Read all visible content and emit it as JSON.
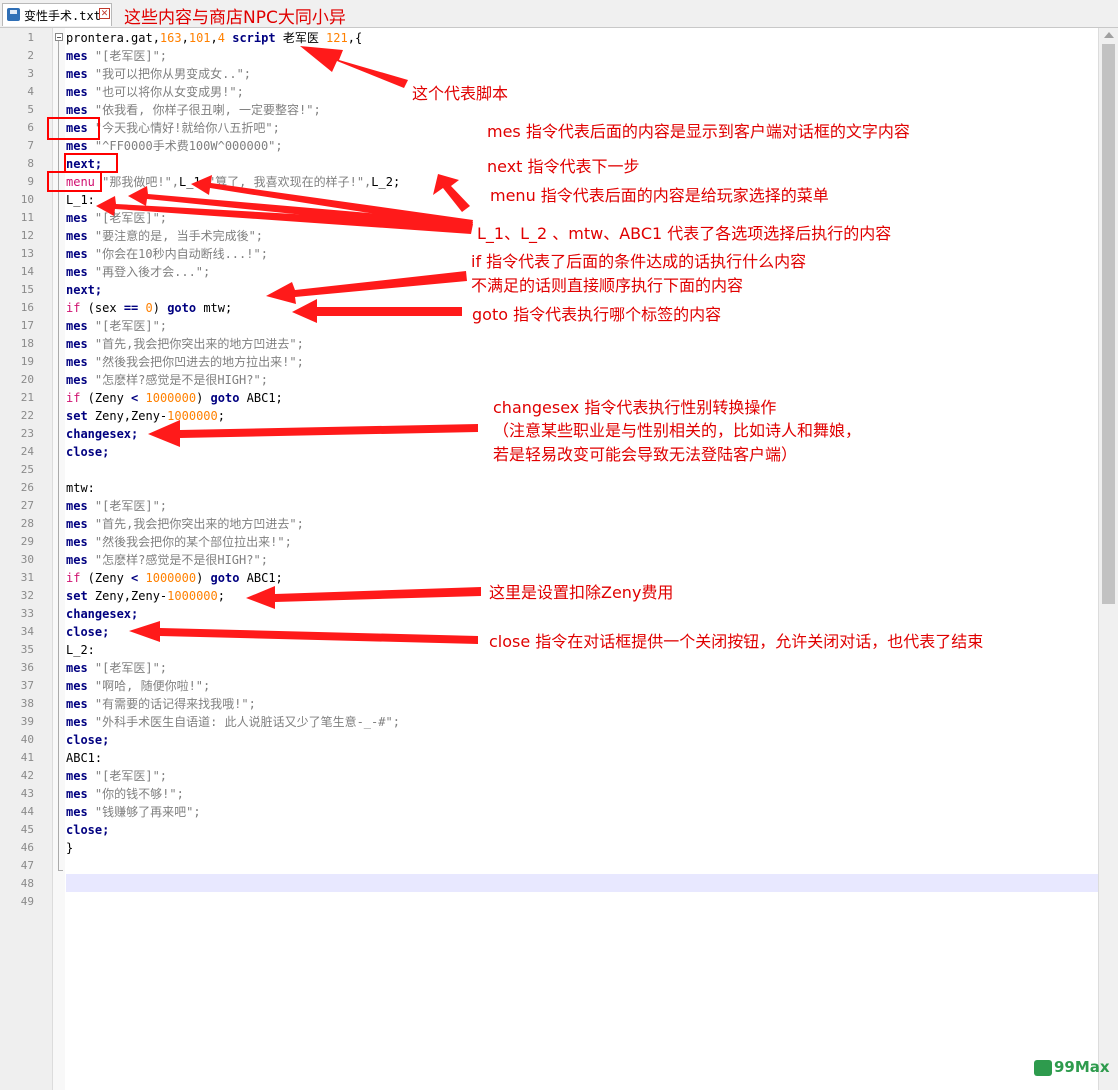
{
  "tab": {
    "title": "变性手术.txt",
    "close_glyph": "✕"
  },
  "header_note": "这些内容与商店NPC大同小异",
  "code_lines": [
    [
      [
        "prontera.gat,",
        ""
      ],
      [
        "163",
        "n"
      ],
      [
        ",",
        ""
      ],
      [
        "101",
        "n"
      ],
      [
        ",",
        ""
      ],
      [
        "4",
        "n"
      ],
      [
        " ",
        ""
      ],
      [
        "script",
        "k"
      ],
      [
        " 老军医 ",
        ""
      ],
      [
        "121",
        "n"
      ],
      [
        ",{",
        ""
      ]
    ],
    [
      [
        "mes",
        "k"
      ],
      [
        " \"[老军医]\";",
        "s"
      ]
    ],
    [
      [
        "mes",
        "k"
      ],
      [
        " \"我可以把你从男变成女..\";",
        "s"
      ]
    ],
    [
      [
        "mes",
        "k"
      ],
      [
        " \"也可以将你从女变成男!\";",
        "s"
      ]
    ],
    [
      [
        "mes",
        "k"
      ],
      [
        " \"依我看, 你样子很丑喇, 一定要整容!\";",
        "s"
      ]
    ],
    [
      [
        "mes",
        "k"
      ],
      [
        " \"今天我心情好!就给你八五折吧\";",
        "s"
      ]
    ],
    [
      [
        "mes",
        "k"
      ],
      [
        " \"^FF0000手术费100W^000000\";",
        "s"
      ]
    ],
    [
      [
        "next;",
        "k"
      ]
    ],
    [
      [
        "menu",
        "m"
      ],
      [
        " \"那我做吧!\",",
        "s"
      ],
      [
        "L_1,",
        ""
      ],
      [
        "\"算了, 我喜欢现在的样子!\",",
        "s"
      ],
      [
        "L_2;",
        ""
      ]
    ],
    [
      [
        "L_1:",
        ""
      ]
    ],
    [
      [
        "mes",
        "k"
      ],
      [
        " \"[老军医]\";",
        "s"
      ]
    ],
    [
      [
        "mes",
        "k"
      ],
      [
        " \"要注意的是, 当手术完成後\";",
        "s"
      ]
    ],
    [
      [
        "mes",
        "k"
      ],
      [
        " \"你会在10秒内自动断线...!\";",
        "s"
      ]
    ],
    [
      [
        "mes",
        "k"
      ],
      [
        " \"再登入後才会...\";",
        "s"
      ]
    ],
    [
      [
        "next;",
        "k"
      ]
    ],
    [
      [
        "if",
        "m"
      ],
      [
        " (sex ",
        ""
      ],
      [
        "==",
        "k"
      ],
      [
        " ",
        ""
      ],
      [
        "0",
        "n"
      ],
      [
        ") ",
        ""
      ],
      [
        "goto",
        "k"
      ],
      [
        " mtw;",
        ""
      ]
    ],
    [
      [
        "mes",
        "k"
      ],
      [
        " \"[老军医]\";",
        "s"
      ]
    ],
    [
      [
        "mes",
        "k"
      ],
      [
        " \"首先,我会把你突出来的地方凹进去\";",
        "s"
      ]
    ],
    [
      [
        "mes",
        "k"
      ],
      [
        " \"然後我会把你凹进去的地方拉出来!\";",
        "s"
      ]
    ],
    [
      [
        "mes",
        "k"
      ],
      [
        " \"怎麽样?感觉是不是很HIGH?\";",
        "s"
      ]
    ],
    [
      [
        "if",
        "m"
      ],
      [
        " (Zeny ",
        ""
      ],
      [
        "<",
        "k"
      ],
      [
        " ",
        ""
      ],
      [
        "1000000",
        "n"
      ],
      [
        ") ",
        ""
      ],
      [
        "goto",
        "k"
      ],
      [
        " ABC1;",
        ""
      ]
    ],
    [
      [
        "set",
        "k"
      ],
      [
        " Zeny,Zeny-",
        ""
      ],
      [
        "1000000",
        "n"
      ],
      [
        ";",
        ""
      ]
    ],
    [
      [
        "changesex;",
        "k"
      ]
    ],
    [
      [
        "close;",
        "k"
      ]
    ],
    [],
    [
      [
        "mtw:",
        ""
      ]
    ],
    [
      [
        "mes",
        "k"
      ],
      [
        " \"[老军医]\";",
        "s"
      ]
    ],
    [
      [
        "mes",
        "k"
      ],
      [
        " \"首先,我会把你突出来的地方凹进去\";",
        "s"
      ]
    ],
    [
      [
        "mes",
        "k"
      ],
      [
        " \"然後我会把你的某个部位拉出来!\";",
        "s"
      ]
    ],
    [
      [
        "mes",
        "k"
      ],
      [
        " \"怎麽样?感觉是不是很HIGH?\";",
        "s"
      ]
    ],
    [
      [
        "if",
        "m"
      ],
      [
        " (Zeny ",
        ""
      ],
      [
        "<",
        "k"
      ],
      [
        " ",
        ""
      ],
      [
        "1000000",
        "n"
      ],
      [
        ") ",
        ""
      ],
      [
        "goto",
        "k"
      ],
      [
        " ABC1;",
        ""
      ]
    ],
    [
      [
        "set",
        "k"
      ],
      [
        " Zeny,Zeny-",
        ""
      ],
      [
        "1000000",
        "n"
      ],
      [
        ";",
        ""
      ]
    ],
    [
      [
        "changesex;",
        "k"
      ]
    ],
    [
      [
        "close;",
        "k"
      ]
    ],
    [
      [
        "L_2:",
        ""
      ]
    ],
    [
      [
        "mes",
        "k"
      ],
      [
        " \"[老军医]\";",
        "s"
      ]
    ],
    [
      [
        "mes",
        "k"
      ],
      [
        " \"啊哈, 随便你啦!\";",
        "s"
      ]
    ],
    [
      [
        "mes",
        "k"
      ],
      [
        " \"有需要的话记得来找我哦!\";",
        "s"
      ]
    ],
    [
      [
        "mes",
        "k"
      ],
      [
        " \"外科手术医生自语道: 此人说脏话又少了笔生意-_-#\";",
        "s"
      ]
    ],
    [
      [
        "close;",
        "k"
      ]
    ],
    [
      [
        "ABC1:",
        ""
      ]
    ],
    [
      [
        "mes",
        "k"
      ],
      [
        " \"[老军医]\";",
        "s"
      ]
    ],
    [
      [
        "mes",
        "k"
      ],
      [
        " \"你的钱不够!\";",
        "s"
      ]
    ],
    [
      [
        "mes",
        "k"
      ],
      [
        " \"钱赚够了再来吧\";",
        "s"
      ]
    ],
    [
      [
        "close;",
        "k"
      ]
    ],
    [
      [
        "}",
        ""
      ]
    ],
    [],
    [],
    []
  ],
  "annotations": [
    "这个代表脚本",
    "mes 指令代表后面的内容是显示到客户端对话框的文字内容",
    "next 指令代表下一步",
    "menu 指令代表后面的内容是给玩家选择的菜单",
    "L_1、L_2 、mtw、ABC1 代表了各选项选择后执行的内容",
    "if 指令代表了后面的条件达成的话执行什么内容",
    "不满足的话则直接顺序执行下面的内容",
    "goto 指令代表执行哪个标签的内容",
    "changesex 指令代表执行性别转换操作",
    "（注意某些职业是与性别相关的，比如诗人和舞娘，",
    "若是轻易改变可能会导致无法登陆客户端）",
    "这里是设置扣除Zeny费用",
    "close 指令在对话框提供一个关闭按钮，允许关闭对话，也代表了结束"
  ],
  "watermark": {
    "text": "99Max"
  },
  "colors": {
    "annotation": "#e00000",
    "keyword": "#000080",
    "number": "#ff8000",
    "string": "#808080",
    "menu_if": "#d01070",
    "current_line": "#e8e8ff"
  }
}
